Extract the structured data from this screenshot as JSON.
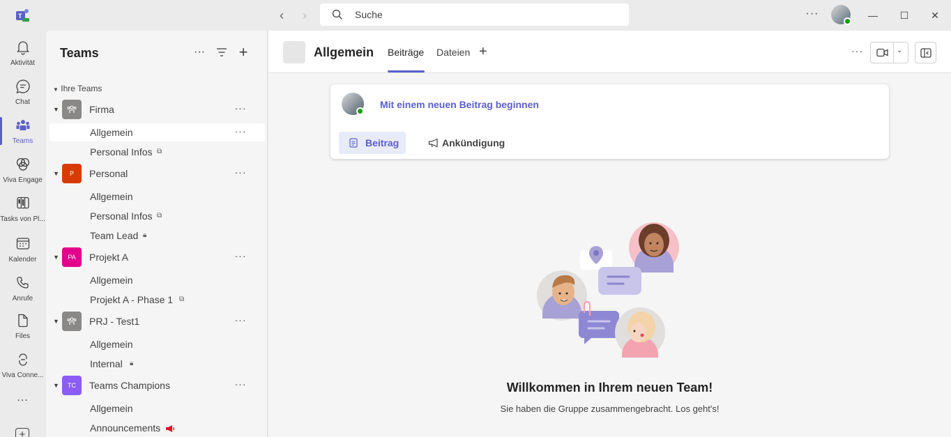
{
  "search": {
    "placeholder": "Suche"
  },
  "rail": {
    "items": [
      {
        "label": "Aktivität",
        "icon": "bell-icon"
      },
      {
        "label": "Chat",
        "icon": "chat-icon"
      },
      {
        "label": "Teams",
        "icon": "teams-icon"
      },
      {
        "label": "Viva Engage",
        "icon": "engage-icon"
      },
      {
        "label": "Tasks von Pl...",
        "icon": "tasks-icon"
      },
      {
        "label": "Kalender",
        "icon": "calendar-icon"
      },
      {
        "label": "Anrufe",
        "icon": "phone-icon"
      },
      {
        "label": "Files",
        "icon": "file-icon"
      },
      {
        "label": "Viva Conne...",
        "icon": "connections-icon"
      }
    ],
    "more": "..."
  },
  "teams_pane": {
    "title": "Teams",
    "section": "Ihre Teams",
    "teams": [
      {
        "name": "Firma",
        "avatar": "",
        "color": "#8a8886",
        "channels": [
          {
            "name": "Allgemein"
          },
          {
            "name": "Personal Infos"
          }
        ]
      },
      {
        "name": "Personal",
        "avatar": "P",
        "color": "#d83b01",
        "channels": [
          {
            "name": "Allgemein"
          },
          {
            "name": "Personal Infos"
          },
          {
            "name": "Team Lead"
          }
        ]
      },
      {
        "name": "Projekt A",
        "avatar": "PA",
        "color": "#e3008c",
        "channels": [
          {
            "name": "Allgemein"
          },
          {
            "name": "Projekt A - Phase 1"
          }
        ]
      },
      {
        "name": "PRJ - Test1",
        "avatar": "",
        "color": "#8a8886",
        "channels": [
          {
            "name": "Allgemein"
          },
          {
            "name": "Internal"
          }
        ]
      },
      {
        "name": "Teams Champions",
        "avatar": "TC",
        "color": "#8b5cf6",
        "channels": [
          {
            "name": "Allgemein"
          },
          {
            "name": "Announcements"
          }
        ]
      }
    ]
  },
  "main": {
    "channel_title": "Allgemein",
    "tabs": [
      {
        "label": "Beiträge"
      },
      {
        "label": "Dateien"
      }
    ],
    "compose": {
      "prompt": "Mit einem neuen Beitrag beginnen",
      "post_label": "Beitrag",
      "announcement_label": "Ankündigung"
    },
    "welcome_title": "Willkommen in Ihrem neuen Team!",
    "welcome_subtitle": "Sie haben die Gruppe zusammengebracht. Los geht's!"
  },
  "colors": {
    "accent": "#5b5fc7",
    "presence": "#13a10e"
  }
}
